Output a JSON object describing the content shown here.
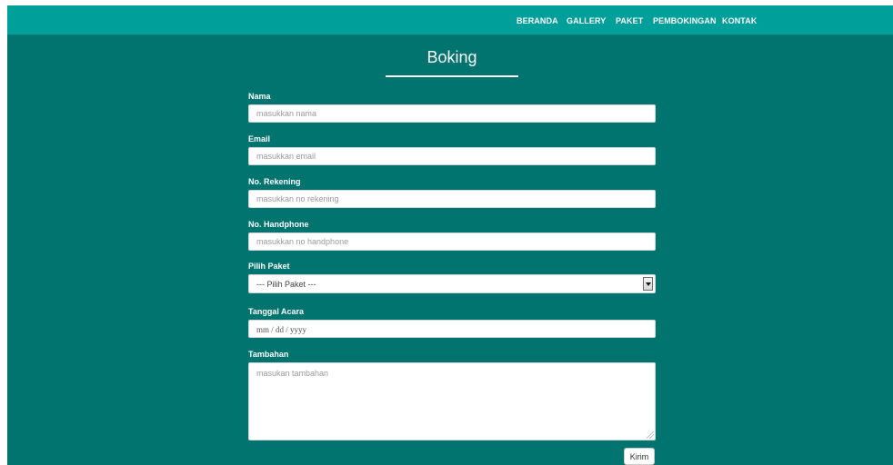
{
  "nav": {
    "items": [
      {
        "label": "BERANDA"
      },
      {
        "label": "GALLERY"
      },
      {
        "label": "PAKET"
      },
      {
        "label": "PEMBOKINGAN"
      },
      {
        "label": "KONTAK"
      }
    ]
  },
  "page": {
    "title": "Boking"
  },
  "form": {
    "nama": {
      "label": "Nama",
      "placeholder": "masukkan nama",
      "value": ""
    },
    "email": {
      "label": "Email",
      "placeholder": "masukkan email",
      "value": ""
    },
    "rekening": {
      "label": "No. Rekening",
      "placeholder": "masukkan no rekening",
      "value": ""
    },
    "handphone": {
      "label": "No. Handphone",
      "placeholder": "masukkan no handphone",
      "value": ""
    },
    "paket": {
      "label": "Pilih Paket",
      "selected": "--- Pilih Paket ---"
    },
    "tanggal": {
      "label": "Tanggal Acara",
      "mask": "mm / dd / yyyy"
    },
    "tambahan": {
      "label": "Tambahan",
      "placeholder": "masukan tambahan",
      "value": ""
    },
    "submit_label": "Kirim"
  },
  "colors": {
    "background": "#017470",
    "navbar": "#019f99",
    "text": "#ffffff"
  }
}
